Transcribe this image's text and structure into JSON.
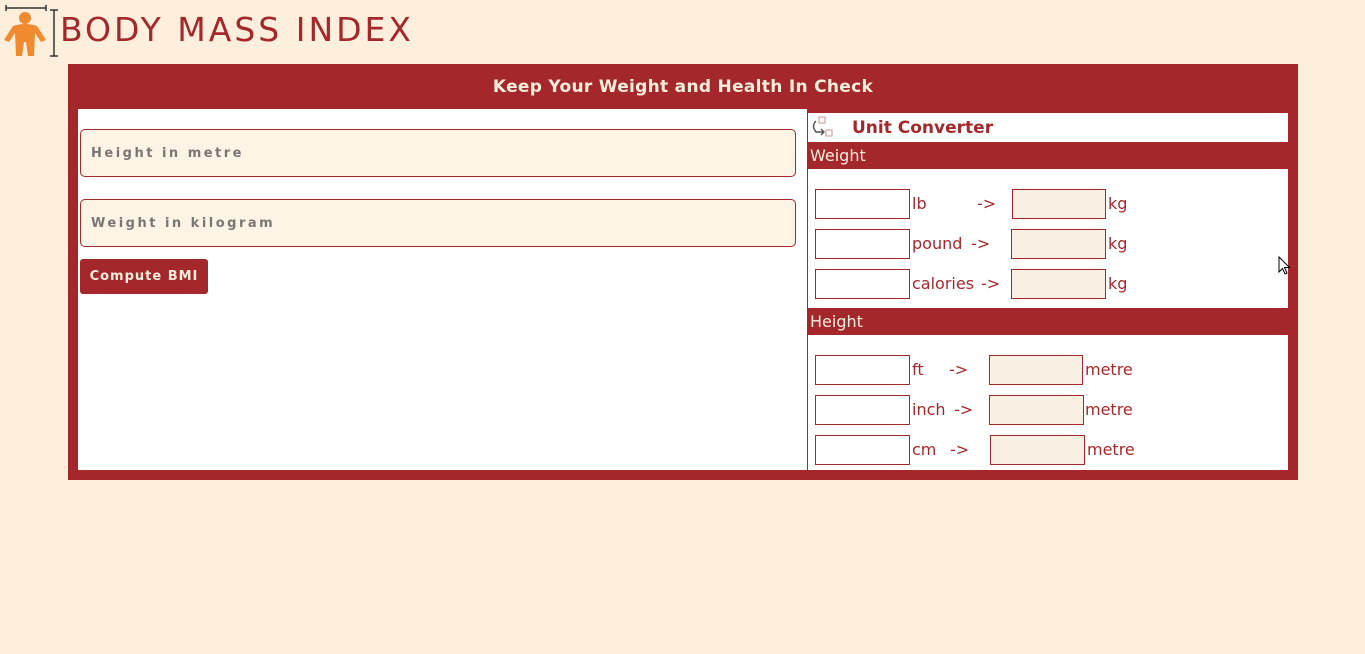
{
  "app": {
    "title": "BODY MASS INDEX"
  },
  "panel": {
    "header": "Keep Your Weight and Health In Check"
  },
  "bmi_form": {
    "height_placeholder": "Height in metre",
    "weight_placeholder": "Weight in kilogram",
    "compute_label": "Compute BMI"
  },
  "converter": {
    "title": "Unit Converter",
    "weight": {
      "heading": "Weight",
      "rows": [
        {
          "from": "lb",
          "arrow": "->",
          "to": "kg"
        },
        {
          "from": "pound",
          "arrow": "->",
          "to": "kg"
        },
        {
          "from": "calories",
          "arrow": "->",
          "to": "kg"
        }
      ]
    },
    "height": {
      "heading": "Height",
      "rows": [
        {
          "from": "ft",
          "arrow": "->",
          "to": "metre"
        },
        {
          "from": "inch",
          "arrow": "->",
          "to": "metre"
        },
        {
          "from": "cm",
          "arrow": "->",
          "to": "metre"
        }
      ]
    }
  },
  "colors": {
    "page_bg": "#feefdc",
    "brand": "#a4282b",
    "logo_orange": "#f08a2e"
  },
  "icons": {
    "logo": "person-height-icon",
    "converter": "convert-icon"
  }
}
